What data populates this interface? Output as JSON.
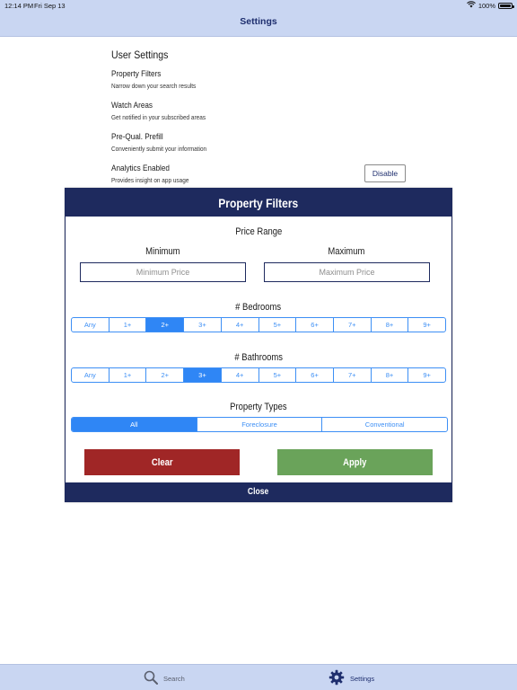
{
  "status_bar": {
    "time": "12:14 PM",
    "date": "Fri Sep 13",
    "battery": "100%"
  },
  "nav": {
    "title": "Settings"
  },
  "settings": {
    "heading": "User Settings",
    "items": [
      {
        "title": "Property Filters",
        "subtitle": "Narrow down your search results"
      },
      {
        "title": "Watch Areas",
        "subtitle": "Get notified in your subscribed areas"
      },
      {
        "title": "Pre-Qual. Prefill",
        "subtitle": "Conveniently submit your information"
      },
      {
        "title": "Analytics Enabled",
        "subtitle": "Provides insight on app usage"
      }
    ],
    "disable_label": "Disable"
  },
  "modal": {
    "title": "Property Filters",
    "price_range": {
      "title": "Price Range",
      "min_label": "Minimum",
      "max_label": "Maximum",
      "min_placeholder": "Minimum Price",
      "max_placeholder": "Maximum Price"
    },
    "bedrooms": {
      "title": "# Bedrooms",
      "options": [
        "Any",
        "1+",
        "2+",
        "3+",
        "4+",
        "5+",
        "6+",
        "7+",
        "8+",
        "9+"
      ],
      "selected": "2+"
    },
    "bathrooms": {
      "title": "# Bathrooms",
      "options": [
        "Any",
        "1+",
        "2+",
        "3+",
        "4+",
        "5+",
        "6+",
        "7+",
        "8+",
        "9+"
      ],
      "selected": "3+"
    },
    "property_types": {
      "title": "Property Types",
      "options": [
        "All",
        "Foreclosure",
        "Conventional"
      ],
      "selected": "All"
    },
    "clear_label": "Clear",
    "apply_label": "Apply",
    "close_label": "Close"
  },
  "tabbar": {
    "tabs": [
      {
        "label": "Search",
        "icon": "search-icon",
        "active": false
      },
      {
        "label": "Settings",
        "icon": "gear-icon",
        "active": true
      }
    ]
  },
  "colors": {
    "bar_background": "#c9d6f2",
    "navy": "#1e2a5e",
    "segment_blue": "#2f86f5",
    "clear_red": "#a02626",
    "apply_green": "#6aa35a"
  }
}
